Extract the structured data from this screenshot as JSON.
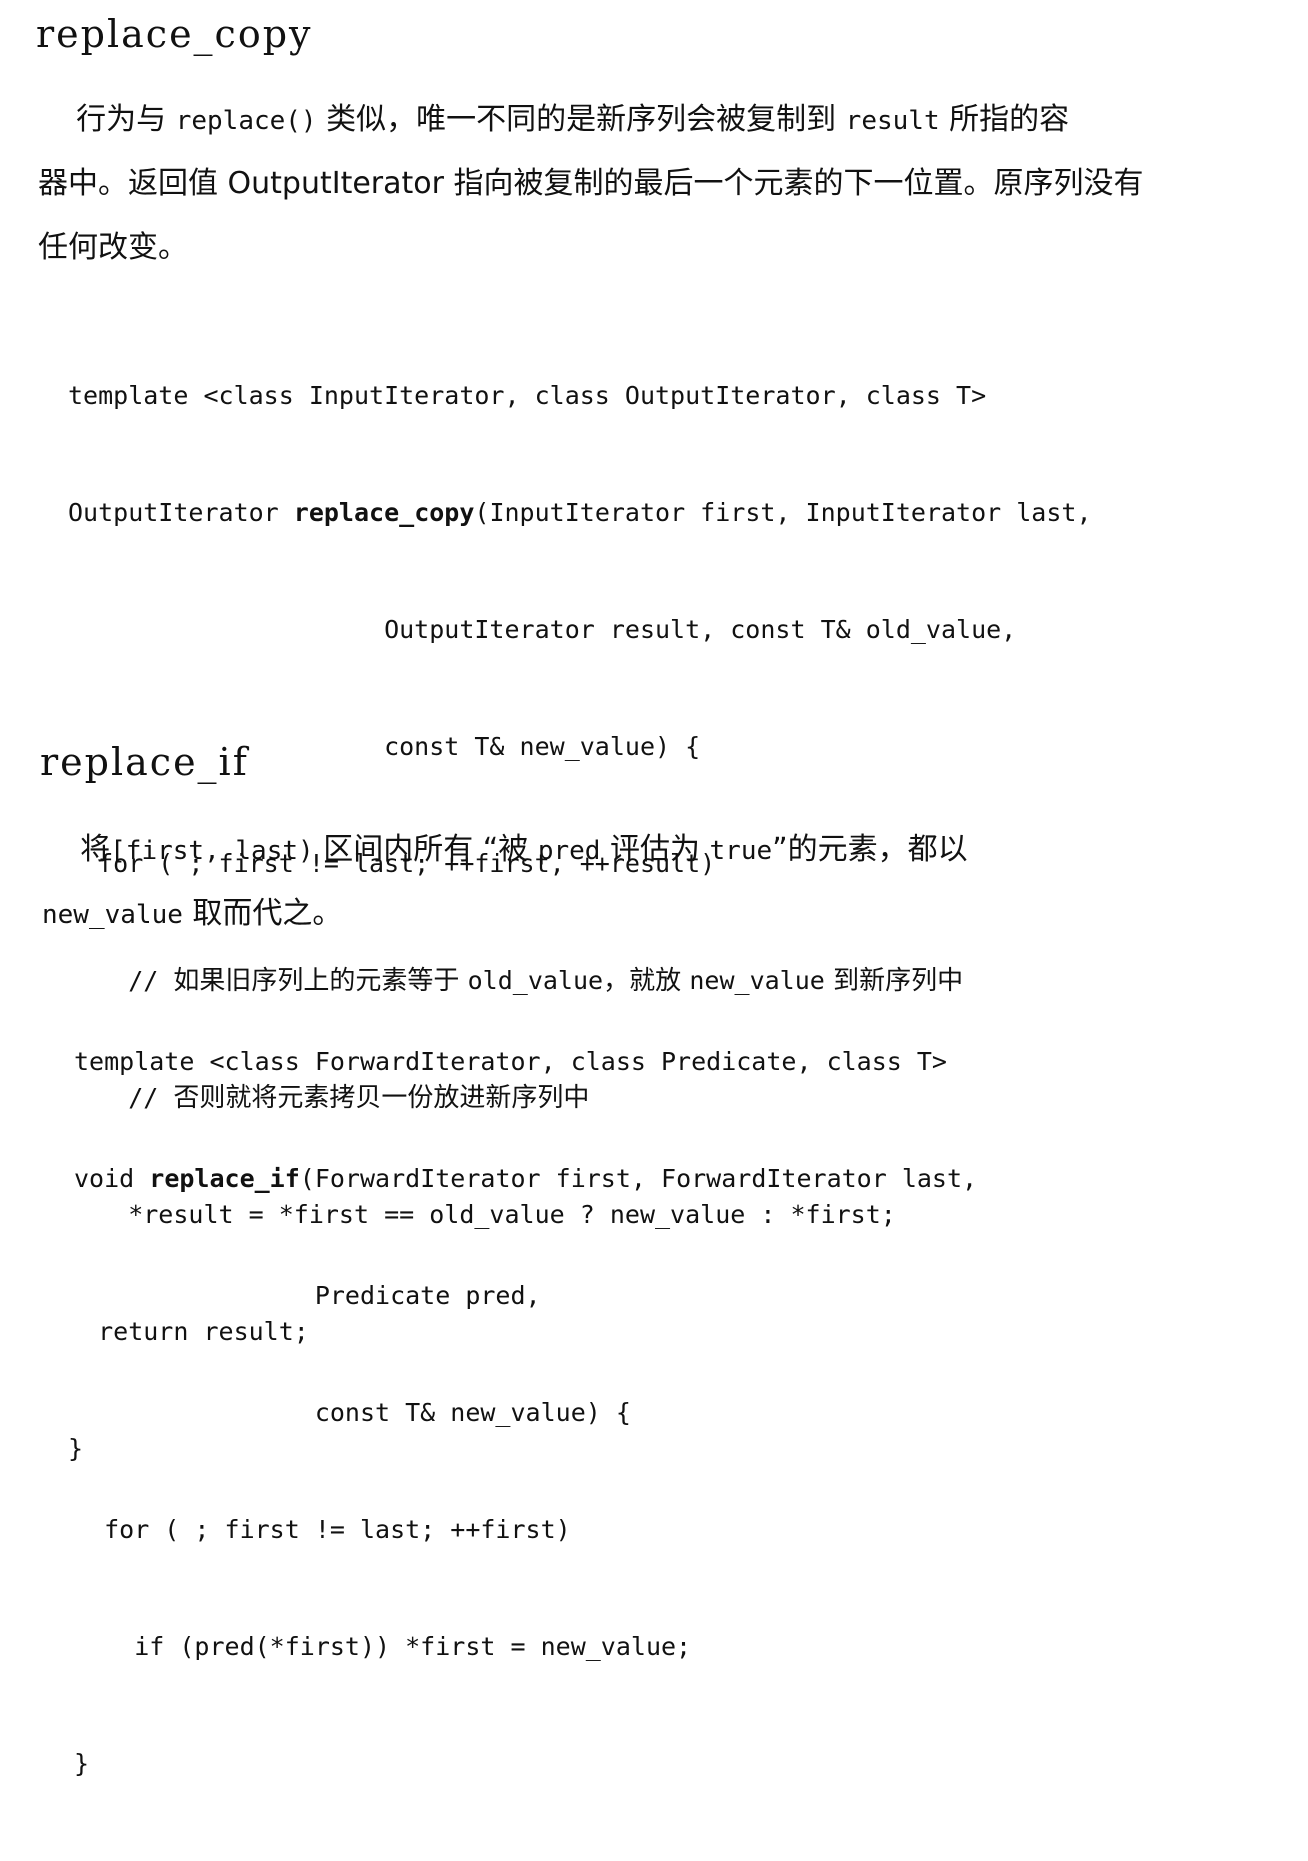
{
  "section1": {
    "title": "replace_copy",
    "para": {
      "l1_a": "行为与 ",
      "l1_code1": "replace()",
      "l1_b": " 类似，唯一不同的是新序列会被复制到 ",
      "l1_code2": "result",
      "l1_c": " 所指的容",
      "l2": "器中。返回值 OutputIterator 指向被复制的最后一个元素的下一位置。原序列没有",
      "l3": "任何改变。"
    },
    "code": {
      "l1": "template <class InputIterator, class OutputIterator, class T>",
      "l2_a": "OutputIterator ",
      "l2_fn": "replace_copy",
      "l2_b": "(InputIterator first, InputIterator last,",
      "l3": "                     OutputIterator result, const T& old_value,",
      "l4": "                     const T& new_value) {",
      "l5": "  for ( ; first != last; ++first, ++result)",
      "l6_a": "    // ",
      "l6_t1": "如果旧序列上的元素等于 ",
      "l6_c": "old_value",
      "l6_t2": "，就放 ",
      "l6_d": "new_value",
      "l6_t3": " 到新序列中",
      "l7_a": "    // ",
      "l7_t1": "否则就将元素拷贝一份放进新序列中",
      "l8": "    *result = *first == old_value ? new_value : *first;",
      "l9": "  return result;",
      "l10": "}"
    }
  },
  "section2": {
    "title": "replace_if",
    "para": {
      "l1_a": "将",
      "l1_code1": "[first, last)",
      "l1_b": " 区间内所有 “被 ",
      "l1_code2": "pred",
      "l1_c": " 评估为 ",
      "l1_code3": "true",
      "l1_d": "”的元素，都以",
      "l2_code": "new_value",
      "l2_b": " 取而代之。"
    },
    "code": {
      "l1": "template <class ForwardIterator, class Predicate, class T>",
      "l2_a": "void ",
      "l2_fn": "replace_if",
      "l2_b": "(ForwardIterator first, ForwardIterator last,",
      "l3": "                Predicate pred,",
      "l4": "                const T& new_value) {",
      "l5": "  for ( ; first != last; ++first)",
      "l6": "    if (pred(*first)) *first = new_value;",
      "l7": "}"
    }
  }
}
